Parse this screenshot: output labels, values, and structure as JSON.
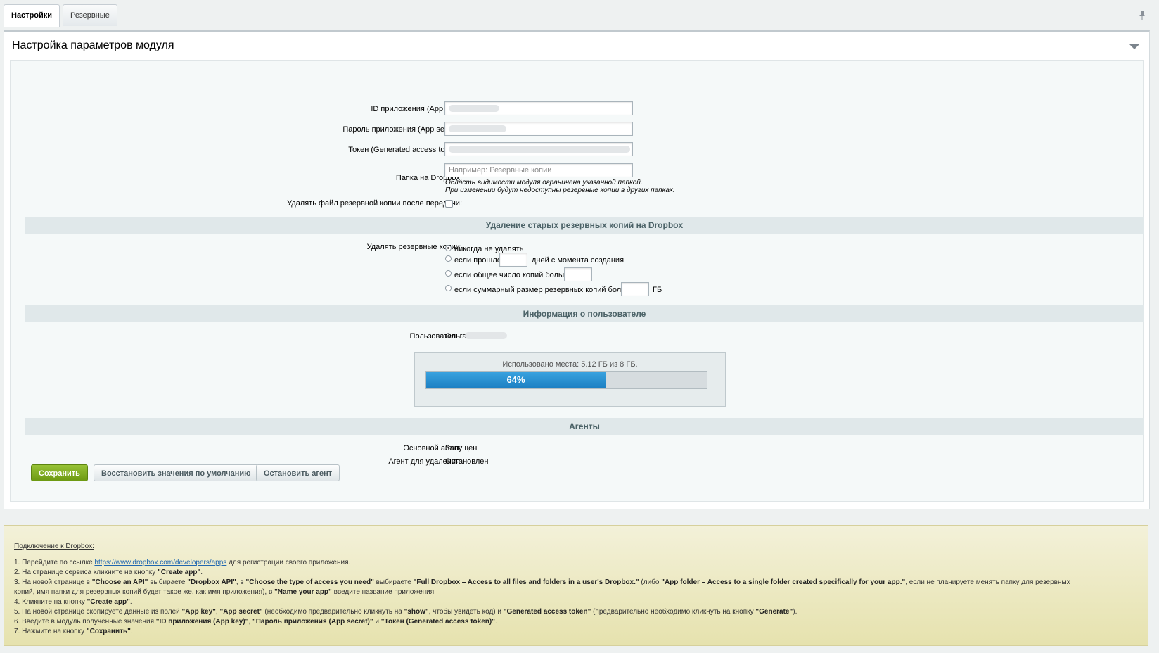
{
  "tabs": {
    "settings": "Настройки",
    "backups": "Резервные копии"
  },
  "panel": {
    "title": "Настройка параметров модуля"
  },
  "form": {
    "app_key_label": "ID приложения (App key):",
    "app_secret_label": "Пароль приложения (App secret):",
    "token_label": "Токен (Generated access token):",
    "folder_label": "Папка на Dropbox:",
    "folder_placeholder": "Например: Резервные копии",
    "folder_hint1": "Область видимости модуля ограничена указанной папкой.",
    "folder_hint2": "При изменении будут недоступны резервные копии в других папках.",
    "delete_after_label": "Удалять файл резервной копии после передачи:"
  },
  "cleanup": {
    "section": "Удаление старых резервных копий на Dropbox",
    "label": "Удалять резервные копии:",
    "opt_never": "никогда не удалять",
    "opt_days_pre": "если прошло",
    "opt_days_post": "дней с момента создания",
    "opt_count": "если общее число копий больше",
    "opt_size": "если суммарный размер резервных копий больше",
    "opt_size_unit": "ГБ"
  },
  "user": {
    "section": "Информация о пользователе",
    "label": "Пользователь:",
    "name": "Ольга",
    "usage_text": "Использовано места: 5.12 ГБ из 8 ГБ.",
    "usage_percent": 64,
    "usage_label": "64%"
  },
  "agents": {
    "section": "Агенты",
    "main_label": "Основной агент:",
    "main_value": "Запущен",
    "delete_label": "Агент для удаления:",
    "delete_value": "Остановлен"
  },
  "buttons": {
    "save": "Сохранить",
    "restore": "Восстановить значения по умолчанию",
    "stop": "Остановить агент"
  },
  "help": {
    "title": "Подключение к Dropbox:",
    "l1_pre": "1. Перейдите по ссылке ",
    "l1_link": "https://www.dropbox.com/developers/apps",
    "l1_post": " для регистрации своего приложения.",
    "l2_pre": "2. На странице сервиса кликните на кнопку ",
    "l2_b": "\"Create app\"",
    "l2_post": ".",
    "l3_a": "3. На новой странице в ",
    "l3_b1": "\"Choose an API\"",
    "l3_c": " выбираете ",
    "l3_b2": "\"Dropbox API\"",
    "l3_d": ", в ",
    "l3_b3": "\"Choose the type of access you need\"",
    "l3_e": " выбираете ",
    "l3_b4": "\"Full Dropbox – Access to all files and folders in a user's Dropbox.\"",
    "l3_f": " (либо ",
    "l3_b5": "\"App folder – Access to a single folder created specifically for your app.\"",
    "l3_g": ", если не планируете менять папку для резервных",
    "l3_h": "копий, имя папки для резервных копий будет такое же, как имя приложения), в ",
    "l3_b6": "\"Name your app\"",
    "l3_i": " введите название приложения.",
    "l4_pre": "4. Кликните на кнопку ",
    "l4_b": "\"Create app\"",
    "l4_post": ".",
    "l5_a": "5. На новой странице скопируете данные из полей ",
    "l5_b1": "\"App key\"",
    "l5_c": ", ",
    "l5_b2": "\"App secret\"",
    "l5_d": " (необходимо предварительно кликнуть на ",
    "l5_b3": "\"show\"",
    "l5_e": ", чтобы увидеть код) и ",
    "l5_b4": "\"Generated access token\"",
    "l5_f": " (предварительно необходимо кликнуть на кнопку ",
    "l5_b5": "\"Generate\"",
    "l5_g": ").",
    "l6_a": "6. Введите в модуль полученные значения ",
    "l6_b1": "\"ID приложения (App key)\"",
    "l6_c": ", ",
    "l6_b2": "\"Пароль приложения (App secret)\"",
    "l6_d": " и ",
    "l6_b3": "\"Токен (Generated access token)\"",
    "l6_e": ".",
    "l7_pre": "7. Нажмите на кнопку ",
    "l7_b": "\"Сохранить\"",
    "l7_post": "."
  }
}
